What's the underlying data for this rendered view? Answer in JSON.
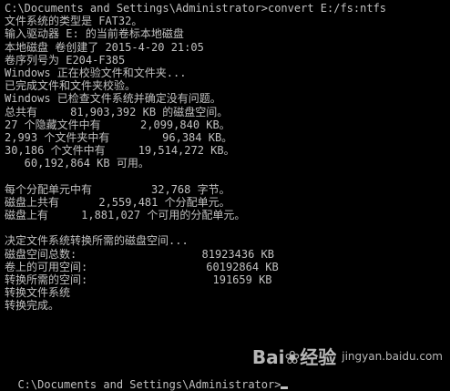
{
  "console": {
    "lines": [
      "C:\\Documents and Settings\\Administrator>convert E:/fs:ntfs",
      "文件系统的类型是 FAT32。",
      "输入驱动器 E: 的当前卷标本地磁盘",
      "本地磁盘 卷创建了 2015-4-20 21:05",
      "卷序列号为 E204-F385",
      "Windows 正在校验文件和文件夹...",
      "已完成文件和文件夹校验。",
      "Windows 已检查文件系统并确定没有问题。",
      "总共有     81,903,392 KB 的磁盘空间。",
      "27 个隐藏文件中有      2,099,840 KB。",
      "2,993 个文件夹中有        96,384 KB。",
      "30,186 个文件中有     19,514,272 KB。",
      "   60,192,864 KB 可用。",
      "",
      "每个分配单元中有         32,768 字节。",
      "磁盘上共有      2,559,481 个分配单元。",
      "磁盘上有     1,881,027 个可用的分配单元。",
      "",
      "决定文件系统转换所需的磁盘空间...",
      "磁盘空间总数:                   81923436 KB",
      "卷上的可用空间:                  60192864 KB",
      "转换所需的空间:                   191659 KB",
      "转换文件系统",
      "转换完成。",
      ""
    ],
    "prompt": "C:\\Documents and Settings\\Administrator>"
  },
  "watermark": {
    "text": "Bai❀经验",
    "sub": "jingyan.baidu.com"
  }
}
